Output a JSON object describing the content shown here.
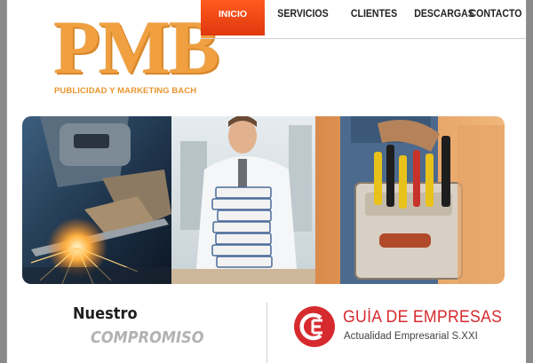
{
  "logo": {
    "mark": "PMB",
    "subtitle": "PUBLICIDAD Y MARKETING BACH"
  },
  "nav": {
    "items": [
      {
        "label": "INICIO",
        "active": true
      },
      {
        "label": "SERVICIOS",
        "active": false
      },
      {
        "label": "CLIENTES",
        "active": false
      },
      {
        "label": "DESCARGAS",
        "active": false
      },
      {
        "label": "CONTACTO",
        "active": false
      }
    ]
  },
  "banner": {
    "panels": [
      "welder-photo",
      "office-worker-photo",
      "tool-belt-photo"
    ]
  },
  "section": {
    "heading_1": "Nuestro",
    "heading_2": "COMPROMISO"
  },
  "partner": {
    "logo_letters": "GE",
    "title": "GUÍA DE EMPRESAS",
    "subtitle": "Actualidad Empresarial S.XXI"
  },
  "colors": {
    "accent": "#ef4a1a",
    "logo_orange": "#f0a040",
    "guia_red": "#d72a2e"
  }
}
